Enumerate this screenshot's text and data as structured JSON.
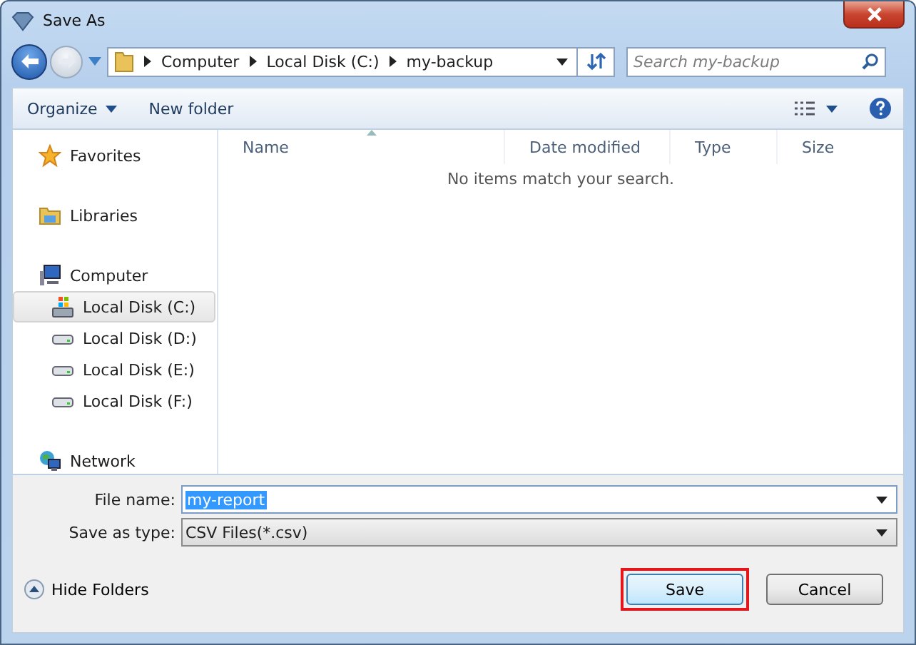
{
  "window": {
    "title": "Save As"
  },
  "address": {
    "crumbs": [
      "Computer",
      "Local Disk (C:)",
      "my-backup"
    ]
  },
  "search": {
    "placeholder": "Search my-backup"
  },
  "toolbar": {
    "buttons": [
      {
        "label": "Organize",
        "dropdown": true
      },
      {
        "label": "New folder",
        "dropdown": false
      }
    ]
  },
  "sidebar": {
    "items": [
      {
        "label": "Favorites",
        "kind": "star",
        "selected": false
      },
      {
        "label": "Libraries",
        "kind": "library",
        "selected": false
      },
      {
        "label": "Computer",
        "kind": "computer",
        "selected": false,
        "children": [
          {
            "label": "Local Disk (C:)",
            "kind": "system-disk",
            "selected": true
          },
          {
            "label": "Local Disk (D:)",
            "kind": "disk",
            "selected": false
          },
          {
            "label": "Local Disk (E:)",
            "kind": "disk",
            "selected": false
          },
          {
            "label": "Local Disk (F:)",
            "kind": "disk",
            "selected": false
          }
        ]
      },
      {
        "label": "Network",
        "kind": "network",
        "selected": false
      }
    ]
  },
  "table": {
    "columns": [
      {
        "label": "Name",
        "sorted": true
      },
      {
        "label": "Date modified",
        "sorted": false
      },
      {
        "label": "Type",
        "sorted": false
      },
      {
        "label": "Size",
        "sorted": false
      }
    ],
    "empty_message": "No items match your search."
  },
  "form": {
    "fields": [
      {
        "label": "File name:",
        "value": "my-report",
        "kind": "editable",
        "selected": true
      },
      {
        "label": "Save as type:",
        "value": "CSV Files(*.csv)",
        "kind": "list",
        "selected": false
      }
    ]
  },
  "footer": {
    "toggle": "Hide Folders",
    "buttons": [
      {
        "label": "Save",
        "highlighted": true
      },
      {
        "label": "Cancel",
        "highlighted": false
      }
    ]
  }
}
